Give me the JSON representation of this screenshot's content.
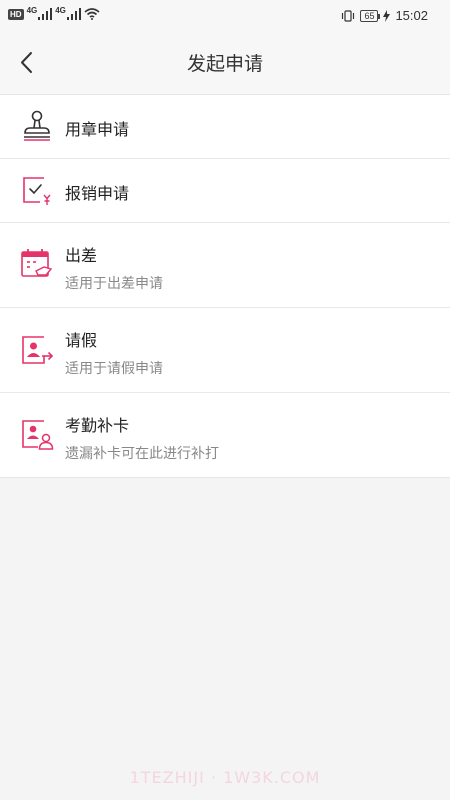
{
  "status_bar": {
    "hd": "HD",
    "net1": "4G",
    "net2": "4G",
    "battery": "65",
    "time": "15:02"
  },
  "header": {
    "title": "发起申请"
  },
  "menu": {
    "items": [
      {
        "title": "用章申请",
        "icon": "stamp-icon"
      },
      {
        "title": "报销申请",
        "icon": "reimbursement-icon"
      },
      {
        "title": "出差",
        "subtitle": "适用于出差申请",
        "icon": "business-trip-icon"
      },
      {
        "title": "请假",
        "subtitle": "适用于请假申请",
        "icon": "leave-icon"
      },
      {
        "title": "考勤补卡",
        "subtitle": "遗漏补卡可在此进行补打",
        "icon": "attendance-icon"
      }
    ]
  },
  "watermark": "1TEZHIJI · 1W3K.COM",
  "colors": {
    "accent": "#e5336b",
    "background": "#f4f4f4",
    "title_text": "#222222",
    "subtitle_text": "#888888"
  }
}
